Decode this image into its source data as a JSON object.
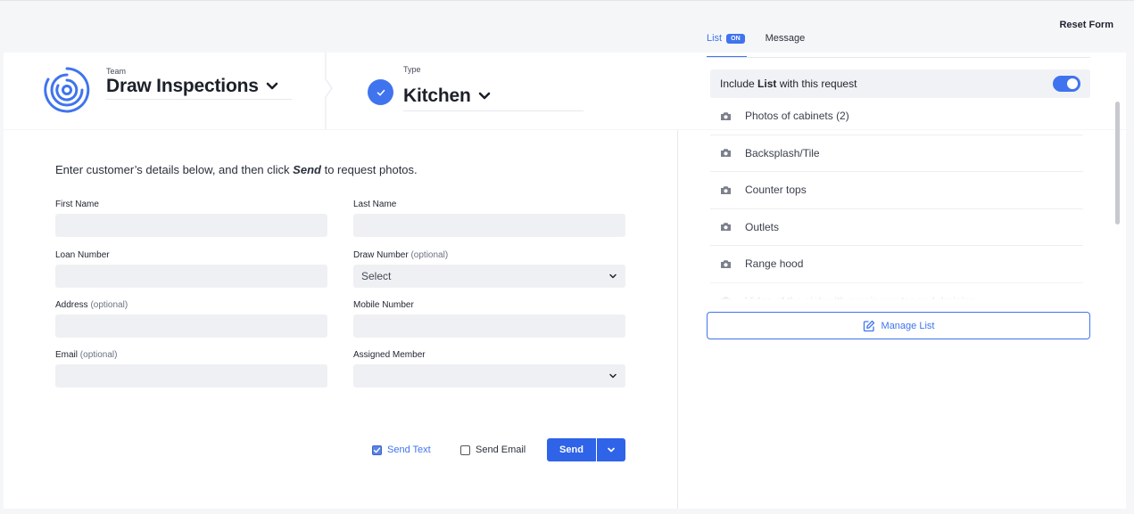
{
  "header": {
    "reset_label": "Reset Form",
    "team_label": "Team",
    "team_value": "Draw Inspections",
    "type_label": "Type",
    "type_value": "Kitchen"
  },
  "form": {
    "intro_before": "Enter customer’s details below, and then click ",
    "intro_bold": "Send",
    "intro_after": " to request photos.",
    "first_name_label": "First Name",
    "last_name_label": "Last Name",
    "loan_number_label": "Loan Number",
    "draw_number_label": "Draw Number",
    "draw_number_optional": "(optional)",
    "draw_number_value": "Select",
    "address_label": "Address",
    "address_optional": "(optional)",
    "mobile_label": "Mobile Number",
    "email_label": "Email",
    "email_optional": "(optional)",
    "assigned_label": "Assigned Member",
    "assigned_value": ""
  },
  "actions": {
    "send_text_label": "Send Text",
    "send_text_checked": true,
    "send_email_label": "Send Email",
    "send_email_checked": false,
    "send_label": "Send"
  },
  "panel": {
    "tab_list": "List",
    "tab_list_badge": "ON",
    "tab_message": "Message",
    "include_before": "Include ",
    "include_bold": "List",
    "include_after": " with this request",
    "include_on": true,
    "items": [
      "Photos of cabinets (2)",
      "Backsplash/Tile",
      "Counter tops",
      "Outlets",
      "Range hood",
      "Video of the sink with running water and draining"
    ],
    "manage_label": "Manage List"
  },
  "colors": {
    "accent": "#3f74ee",
    "button": "#2f63e8",
    "input_bg": "#eff0f3"
  }
}
